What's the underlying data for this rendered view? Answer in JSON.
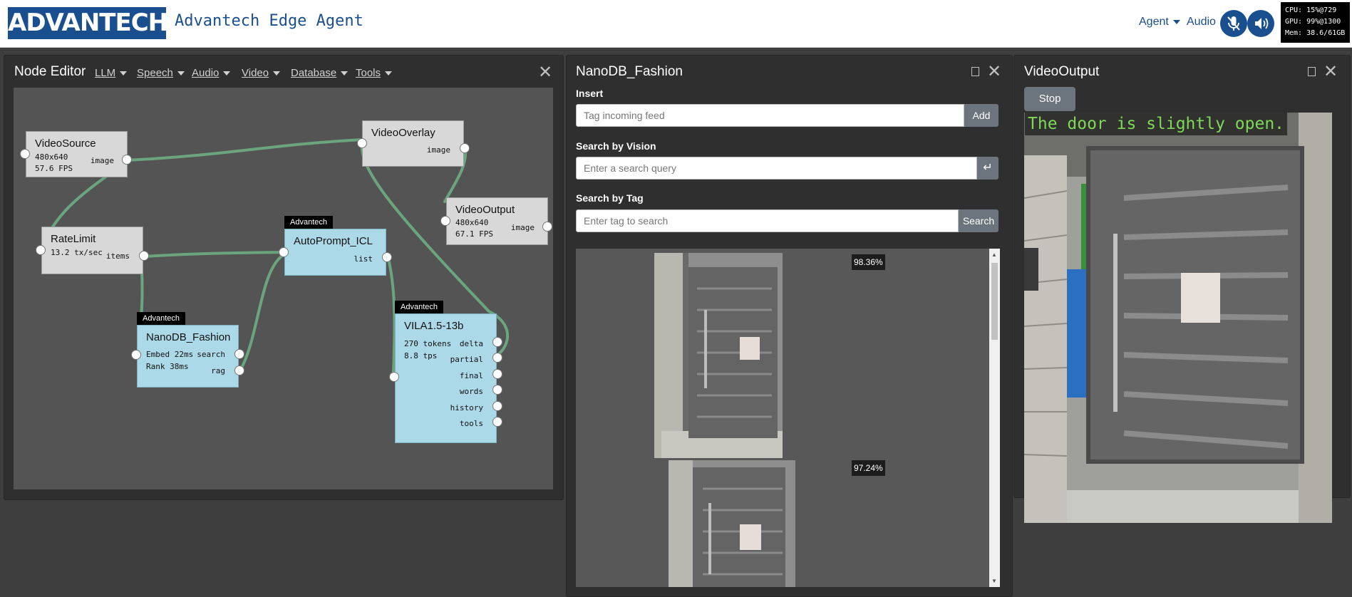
{
  "header": {
    "logo_text": "ADVANTECH",
    "app_title": "Advantech Edge Agent",
    "agent_menu": "Agent",
    "audio_link": "Audio",
    "mic_icon": "microphone-muted-icon",
    "speaker_icon": "speaker-icon",
    "stats": {
      "cpu": "CPU: 15%@729",
      "gpu": "GPU: 99%@1300",
      "mem": "Mem: 38.6/61GB"
    }
  },
  "node_editor": {
    "title": "Node Editor",
    "menus": [
      "LLM",
      "Speech",
      "Audio",
      "Video",
      "Database",
      "Tools"
    ],
    "nodes": {
      "video_source": {
        "title": "VideoSource",
        "line1": "480x640",
        "line2": "57.6 FPS",
        "out": "image"
      },
      "video_overlay": {
        "title": "VideoOverlay",
        "out": "image"
      },
      "video_output": {
        "title": "VideoOutput",
        "line1": "480x640",
        "line2": "67.1 FPS",
        "out": "image"
      },
      "rate_limit": {
        "title": "RateLimit",
        "line1": "13.2 tx/sec",
        "out": "items"
      },
      "autoprompt": {
        "tag": "Advantech",
        "title": "AutoPrompt_ICL",
        "out": "list"
      },
      "nanodb": {
        "tag": "Advantech",
        "title": "NanoDB_Fashion",
        "line1": "Embed 22ms",
        "line2": "Rank 38ms",
        "out1": "search",
        "out2": "rag"
      },
      "vila": {
        "tag": "Advantech",
        "title": "VILA1.5-13b",
        "line1": "270 tokens",
        "line2": "8.8 tps",
        "outs": [
          "delta",
          "partial",
          "final",
          "words",
          "history",
          "tools"
        ]
      }
    }
  },
  "nanodb_panel": {
    "title": "NanoDB_Fashion",
    "insert_label": "Insert",
    "insert_placeholder": "Tag incoming feed",
    "add_button": "Add",
    "vision_label": "Search by Vision",
    "vision_placeholder": "Enter a search query",
    "enter_icon": "enter-icon",
    "tag_label": "Search by Tag",
    "tag_placeholder": "Enter tag to search",
    "search_button": "Search",
    "results": [
      {
        "score": "98.36%"
      },
      {
        "score": "97.24%"
      }
    ]
  },
  "video_panel": {
    "title": "VideoOutput",
    "stop_button": "Stop",
    "caption": "The door is slightly open."
  },
  "colors": {
    "brand_blue": "#1a4f8f",
    "wire_green": "#6aa57e",
    "node_gray": "#d8d8d8",
    "node_blue": "#acd9e8",
    "caption_green": "#7ed957"
  }
}
